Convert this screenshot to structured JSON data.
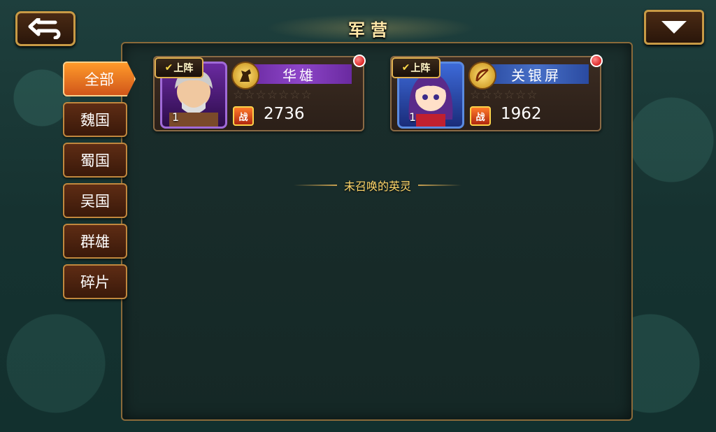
{
  "title": "军营",
  "tabs": [
    "全部",
    "魏国",
    "蜀国",
    "吴国",
    "群雄",
    "碎片"
  ],
  "active_tab": "全部",
  "heroes": [
    {
      "name": "华雄",
      "level": "1",
      "badge": "上阵",
      "power": "2736",
      "stars": "☆☆☆☆☆☆☆",
      "class_icon": "horse-icon",
      "frame_color": "#6a2aa0"
    },
    {
      "name": "关银屏",
      "level": "1",
      "badge": "上阵",
      "power": "1962",
      "stars": "☆☆☆☆☆☆",
      "class_icon": "bow-icon",
      "frame_color": "#2a4aa0"
    }
  ],
  "section_label": "未召唤的英灵",
  "power_icon_label": "战"
}
